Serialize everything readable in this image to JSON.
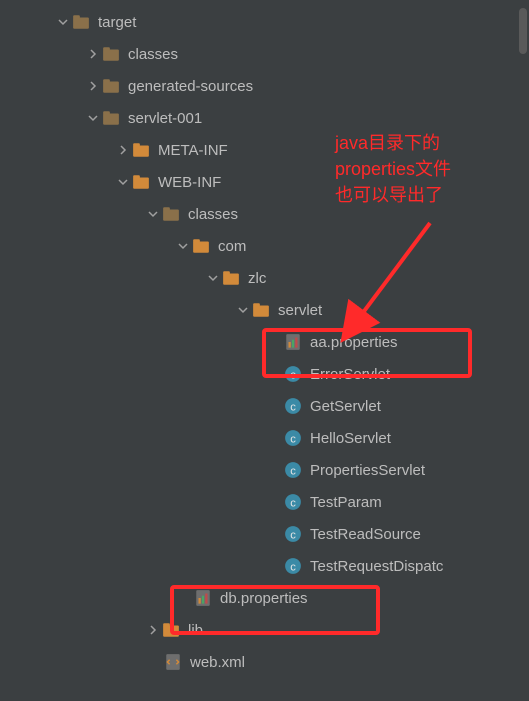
{
  "tree": {
    "target": "target",
    "classes": "classes",
    "gensrc": "generated-sources",
    "servlet001": "servlet-001",
    "metainf": "META-INF",
    "webinf": "WEB-INF",
    "classes2": "classes",
    "com": "com",
    "zlc": "zlc",
    "servlet": "servlet",
    "aa": "aa.properties",
    "errorservlet": "ErrorServlet",
    "getservlet": "GetServlet",
    "helloservlet": "HelloServlet",
    "propservlet": "PropertiesServlet",
    "testparam": "TestParam",
    "testreadsrc": "TestReadSource",
    "testreqdisp": "TestRequestDispatc",
    "db": "db.properties",
    "lib": "lib",
    "webxml": "web.xml"
  },
  "annotation": {
    "line1": "java目录下的",
    "line2": "properties文件",
    "line3": "也可以导出了"
  }
}
